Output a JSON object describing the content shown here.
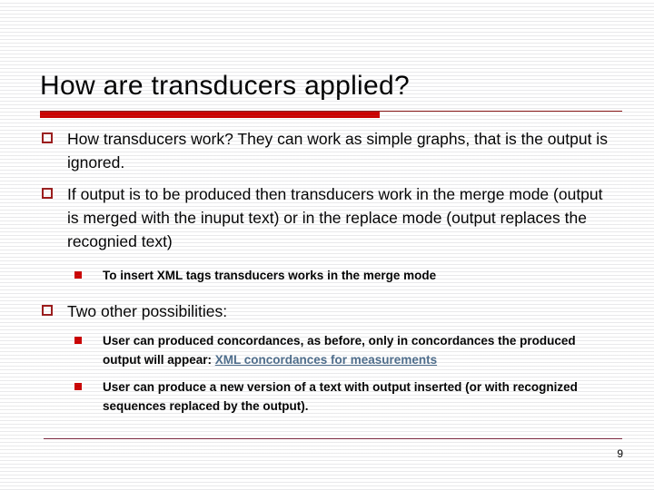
{
  "slide": {
    "title": "How are transducers applied?",
    "page_number": "9",
    "accent_color_bar": "#cc0000",
    "accent_color_rule": "#8b1a1a",
    "bullet_outline_color": "#9c1a1a",
    "bullet_fill_color": "#cc0000",
    "link_color": "#4d6d8c",
    "footer_rule_color": "#7d1b36",
    "text_color": "#000000",
    "background_color": "#ffffff"
  },
  "content": {
    "bullets": [
      {
        "level": 1,
        "text": "How transducers work? They can work as simple graphs, that is the output is ignored."
      },
      {
        "level": 1,
        "text": "If output is to be produced then transducers work in the merge mode (output is merged with the inuput text) or in the replace mode (output replaces the recognied text)"
      },
      {
        "level": 2,
        "text": "To insert XML tags transducers works in the merge mode"
      },
      {
        "level": 1,
        "text": "Two other possibilities:"
      },
      {
        "level": 2,
        "text_before_link": "User can produced concordances, as before, only in concordances the produced output will appear: ",
        "link_text": "XML concordances for measurements"
      },
      {
        "level": 2,
        "text": "User can produce a new version of a text with output inserted (or with recognized sequences replaced by the output)."
      }
    ]
  }
}
